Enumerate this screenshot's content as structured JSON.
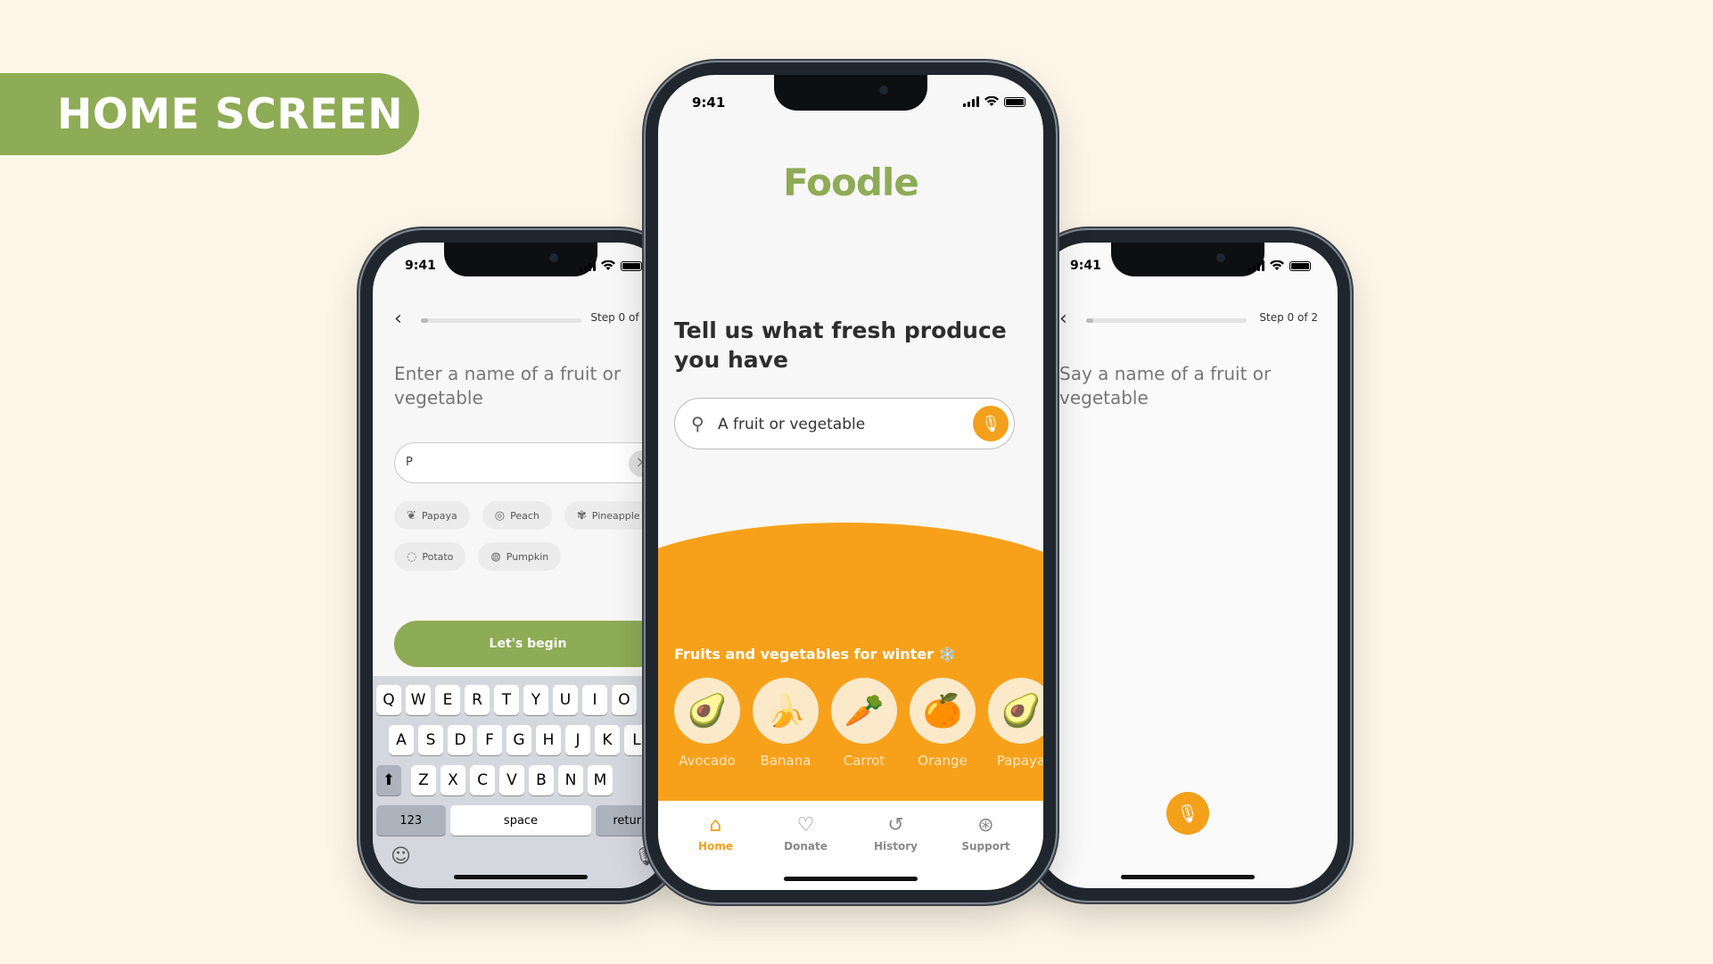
{
  "banner": {
    "title": "HOME SCREEN"
  },
  "status_bar": {
    "time": "9:41"
  },
  "left_phone": {
    "step_label": "Step 0 of 2",
    "prompt": "Enter a name of a fruit or vegetable",
    "input_value": "P",
    "suggestions": [
      {
        "label": "Papaya",
        "icon": "papaya-icon",
        "glyph": "❦"
      },
      {
        "label": "Peach",
        "icon": "peach-icon",
        "glyph": "◎"
      },
      {
        "label": "Pineapple",
        "icon": "pineapple-icon",
        "glyph": "✾"
      },
      {
        "label": "Potato",
        "icon": "potato-icon",
        "glyph": "◌"
      },
      {
        "label": "Pumpkin",
        "icon": "pumpkin-icon",
        "glyph": "◍"
      }
    ],
    "begin_button": "Let's begin",
    "keyboard": {
      "row1": [
        "Q",
        "W",
        "E",
        "R",
        "T",
        "Y",
        "U",
        "I",
        "O"
      ],
      "row2": [
        "A",
        "S",
        "D",
        "F",
        "G",
        "H",
        "J",
        "K",
        "L"
      ],
      "row3": [
        "Z",
        "X",
        "C",
        "V",
        "B",
        "N",
        "M"
      ],
      "num_key": "123",
      "space_key": "space",
      "return_key": "return"
    }
  },
  "center_phone": {
    "logo": "Foodle",
    "headline": "Tell us what fresh produce you have",
    "search_placeholder": "A fruit or vegetable",
    "section_title": "Fruits and vegetables for winter ❄️",
    "produce": [
      {
        "name": "Avocado",
        "emoji": "🥑"
      },
      {
        "name": "Banana",
        "emoji": "🍌"
      },
      {
        "name": "Carrot",
        "emoji": "🥕"
      },
      {
        "name": "Orange",
        "emoji": "🍊"
      },
      {
        "name": "Papaya",
        "emoji": "🥑"
      }
    ],
    "tabs": [
      {
        "label": "Home",
        "icon": "home-icon",
        "glyph": "⌂",
        "active": true
      },
      {
        "label": "Donate",
        "icon": "donate-icon",
        "glyph": "♡",
        "active": false
      },
      {
        "label": "History",
        "icon": "history-icon",
        "glyph": "↺",
        "active": false
      },
      {
        "label": "Support",
        "icon": "support-icon",
        "glyph": "⊛",
        "active": false
      }
    ],
    "accent_color": "#f3a01a",
    "brand_green": "#8eab55"
  },
  "right_phone": {
    "step_label": "Step 0 of 2",
    "prompt": "Say a name of a fruit or vegetable"
  }
}
